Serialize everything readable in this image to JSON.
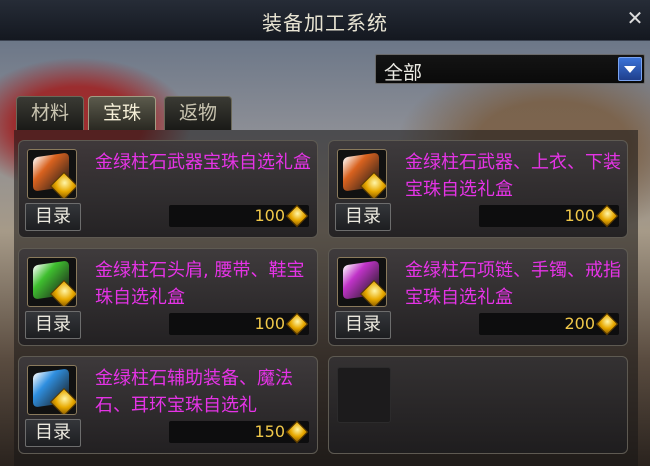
{
  "window": {
    "title": "装备加工系统",
    "close_icon": "close-icon"
  },
  "filter": {
    "selected": "全部"
  },
  "tabs": [
    {
      "label": "材料",
      "active": false
    },
    {
      "label": "宝珠",
      "active": true
    },
    {
      "label": "返物",
      "active": false
    }
  ],
  "items": [
    {
      "name": "金绿柱石武器宝珠自选礼盒",
      "catalog": "目录",
      "price": "100",
      "icon_color": "#d9621f"
    },
    {
      "name": "金绿柱石武器、上衣、下装宝珠自选礼盒",
      "catalog": "目录",
      "price": "100",
      "icon_color": "#d9621f"
    },
    {
      "name": "金绿柱石头肩, 腰带、鞋宝珠自选礼盒",
      "catalog": "目录",
      "price": "100",
      "icon_color": "#3fbf2f"
    },
    {
      "name": "金绿柱石项链、手镯、戒指宝珠自选礼盒",
      "catalog": "目录",
      "price": "200",
      "icon_color": "#c033c8"
    },
    {
      "name": "金绿柱石辅助装备、魔法石、耳环宝珠自选礼",
      "catalog": "目录",
      "price": "150",
      "icon_color": "#2f8fe0"
    }
  ]
}
